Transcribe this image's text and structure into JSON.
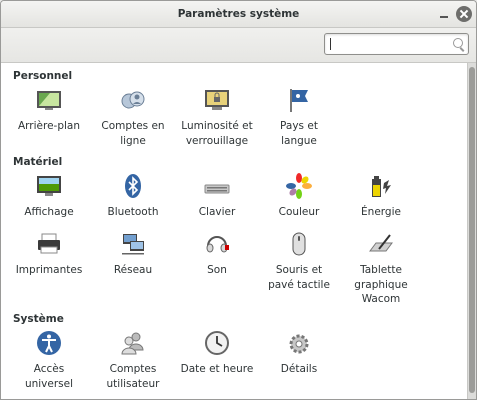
{
  "window": {
    "title": "Paramètres système"
  },
  "search": {
    "placeholder": "",
    "value": ""
  },
  "sections": {
    "personal": {
      "title": "Personnel",
      "items": {
        "background": "Arrière-plan",
        "online_accounts": "Comptes en\nligne",
        "brightness_lock": "Luminosité et\nverrouillage",
        "region_language": "Pays et\nlangue"
      }
    },
    "hardware": {
      "title": "Matériel",
      "items": {
        "display": "Affichage",
        "bluetooth": "Bluetooth",
        "keyboard": "Clavier",
        "color": "Couleur",
        "power": "Énergie",
        "printers": "Imprimantes",
        "network": "Réseau",
        "sound": "Son",
        "mouse_touchpad": "Souris et\npavé tactile",
        "wacom": "Tablette\ngraphique\nWacom"
      }
    },
    "system": {
      "title": "Système",
      "items": {
        "universal_access": "Accès\nuniversel",
        "user_accounts": "Comptes\nutilisateur",
        "date_time": "Date et heure",
        "details": "Détails"
      }
    }
  },
  "icons": {
    "background": "wallpaper-icon",
    "online_accounts": "online-accounts-icon",
    "brightness_lock": "brightness-lock-icon",
    "region_language": "flag-icon",
    "display": "display-icon",
    "bluetooth": "bluetooth-icon",
    "keyboard": "keyboard-icon",
    "color": "color-icon",
    "power": "battery-icon",
    "printers": "printer-icon",
    "network": "network-icon",
    "sound": "sound-icon",
    "mouse_touchpad": "mouse-icon",
    "wacom": "tablet-icon",
    "universal_access": "accessibility-icon",
    "user_accounts": "users-icon",
    "date_time": "clock-icon",
    "details": "gears-icon"
  },
  "colors": {
    "accent": "#3465a4",
    "window_bg": "#ffffff",
    "toolbar_bg": "#e9e9e7"
  }
}
